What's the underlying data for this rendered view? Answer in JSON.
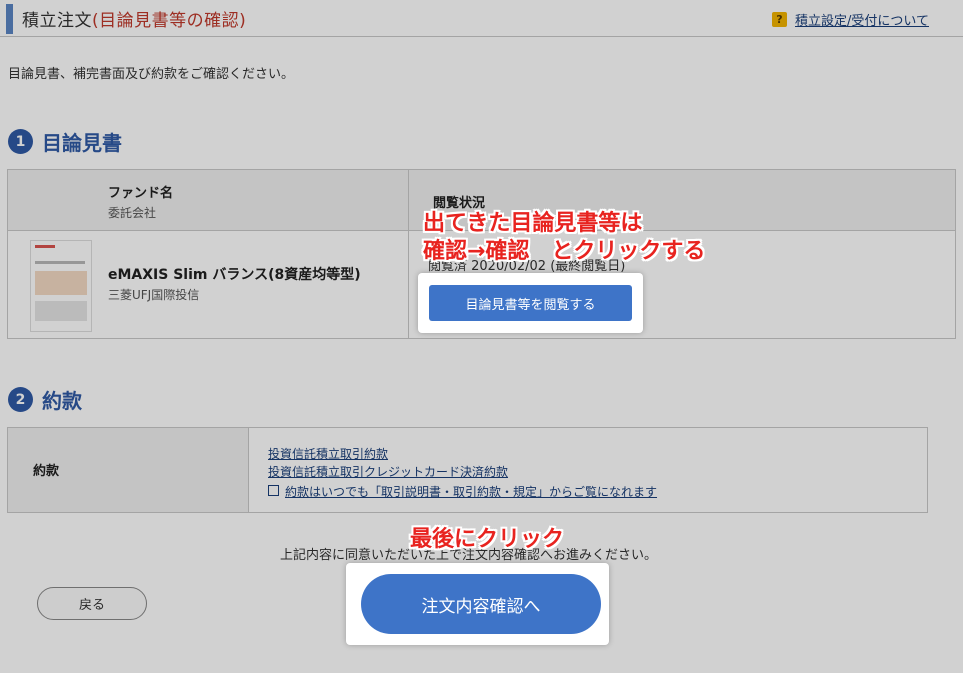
{
  "header": {
    "title_prefix": "積立注文",
    "title_accent": "(目論見書等の確認)",
    "help_icon": "?",
    "help_link": "積立設定/受付について"
  },
  "intro_text": "目論見書、補完書面及び約款をご確認ください。",
  "section1": {
    "number": "1",
    "title": "目論見書",
    "table": {
      "col_fund": "ファンド名",
      "col_fund_sub": "委託会社",
      "col_status": "閲覧状況",
      "row": {
        "fund_name": "eMAXIS Slim バランス(8資産均等型)",
        "company": "三菱UFJ国際投信",
        "viewed_status": "閲覧済 2020/02/02 (最終閲覧日)",
        "view_button": "目論見書等を閲覧する"
      }
    }
  },
  "section2": {
    "number": "2",
    "title": "約款",
    "label": "約款",
    "links": [
      "投資信託積立取引約款",
      "投資信託積立取引クレジットカード決済約款",
      "約款はいつでも「取引説明書・取引約款・規定」からご覧になれます"
    ]
  },
  "agree_text": "上記内容に同意いただいた上で注文内容確認へお進みください。",
  "buttons": {
    "back": "戻る",
    "confirm": "注文内容確認へ"
  },
  "annotations": {
    "line1": "出てきた目論見書等は",
    "line2": "確認→確認　とクリックする",
    "bottom": "最後にクリック"
  },
  "colors": {
    "accent_blue": "#3e74c8",
    "title_red": "#c0392b",
    "annotation_red": "#e8231f"
  }
}
